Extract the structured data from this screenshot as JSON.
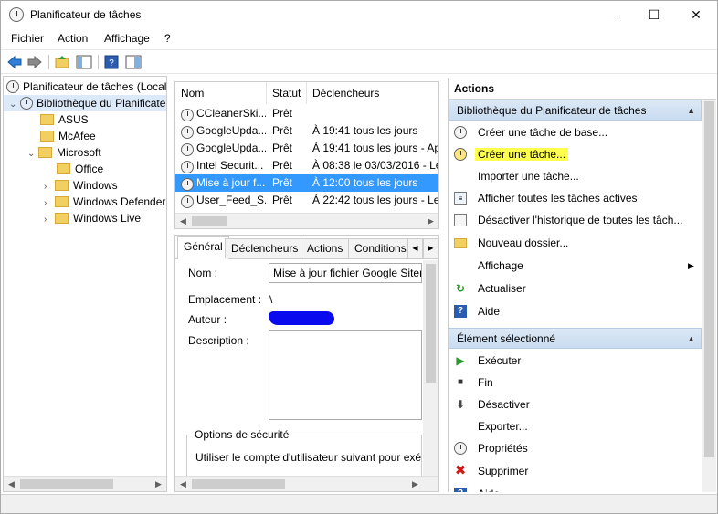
{
  "window": {
    "title": "Planificateur de tâches",
    "minimize": "—",
    "maximize": "☐",
    "close": "✕"
  },
  "menu": {
    "items": [
      "Fichier",
      "Action",
      "Affichage",
      "?"
    ]
  },
  "tree": {
    "root": "Planificateur de tâches (Local)",
    "library": "Bibliothèque du Planificateur de tâches",
    "folders": [
      "ASUS",
      "McAfee",
      "Microsoft"
    ],
    "microsoft_children": [
      "Office",
      "Windows",
      "Windows Defender",
      "Windows Live"
    ]
  },
  "tasklist": {
    "columns": [
      "Nom",
      "Statut",
      "Déclencheurs"
    ],
    "rows": [
      {
        "name": "CCleanerSki...",
        "status": "Prêt",
        "trigger": ""
      },
      {
        "name": "GoogleUpda...",
        "status": "Prêt",
        "trigger": "À 19:41 tous les jours"
      },
      {
        "name": "GoogleUpda...",
        "status": "Prêt",
        "trigger": "À 19:41 tous les jours - Apr"
      },
      {
        "name": "Intel Securit...",
        "status": "Prêt",
        "trigger": "À 08:38 le 03/03/2016 - Le"
      },
      {
        "name": "Mise à jour f...",
        "status": "Prêt",
        "trigger": "À 12:00 tous les jours"
      },
      {
        "name": "User_Feed_S...",
        "status": "Prêt",
        "trigger": "À 22:42 tous les jours - Le c"
      }
    ],
    "selected_index": 4
  },
  "details": {
    "tabs": [
      "Général",
      "Déclencheurs",
      "Actions",
      "Conditions"
    ],
    "name_label": "Nom :",
    "name_value": "Mise à jour fichier Google Sitem",
    "location_label": "Emplacement :",
    "location_value": "\\",
    "author_label": "Auteur :",
    "description_label": "Description :",
    "security_group": "Options de sécurité",
    "security_text": "Utiliser le compte d'utilisateur suivant pour exé"
  },
  "actions": {
    "title": "Actions",
    "section1": "Bibliothèque du Planificateur de tâches",
    "items1": [
      {
        "icon": "clock-icon",
        "label": "Créer une tâche de base..."
      },
      {
        "icon": "clock-icon",
        "label": "Créer une tâche..."
      },
      {
        "icon": "",
        "label": "Importer une tâche..."
      },
      {
        "icon": "list-icon",
        "label": "Afficher toutes les tâches actives"
      },
      {
        "icon": "history-icon",
        "label": "Désactiver l'historique de toutes les tâch..."
      },
      {
        "icon": "folder-icon",
        "label": "Nouveau dossier..."
      },
      {
        "icon": "",
        "label": "Affichage"
      },
      {
        "icon": "refresh-icon",
        "label": "Actualiser"
      },
      {
        "icon": "help-icon",
        "label": "Aide"
      }
    ],
    "section2": "Élément sélectionné",
    "items2": [
      {
        "icon": "play-icon",
        "label": "Exécuter"
      },
      {
        "icon": "stop-icon",
        "label": "Fin"
      },
      {
        "icon": "disable-icon",
        "label": "Désactiver"
      },
      {
        "icon": "",
        "label": "Exporter..."
      },
      {
        "icon": "properties-icon",
        "label": "Propriétés"
      },
      {
        "icon": "delete-icon",
        "label": "Supprimer"
      },
      {
        "icon": "help-icon",
        "label": "Aide"
      }
    ]
  },
  "colors": {
    "selection": "#3399ff",
    "highlight": "#ffff4d",
    "section_header": "#d6e5f4"
  }
}
